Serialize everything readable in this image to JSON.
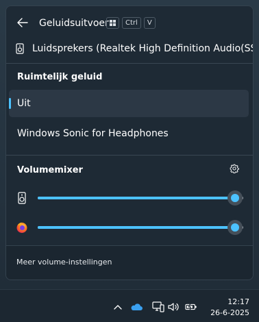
{
  "header": {
    "title": "Geluidsuitvoer",
    "shortcut_keys": [
      "Ctrl",
      "V"
    ]
  },
  "device": {
    "label": "Luidsprekers (Realtek High Definition Audio(SST))",
    "icon": "speaker-icon"
  },
  "spatial_sound": {
    "title": "Ruimtelijk geluid",
    "options": [
      {
        "label": "Uit",
        "selected": true
      },
      {
        "label": "Windows Sonic for Headphones",
        "selected": false
      }
    ]
  },
  "mixer": {
    "title": "Volumemixer",
    "settings_icon": "gear-icon",
    "rows": [
      {
        "app_icon": "speaker-icon",
        "volume_fraction": 0.96
      },
      {
        "app_icon": "firefox-icon",
        "volume_fraction": 0.96
      }
    ]
  },
  "footer": {
    "link": "Meer volume-instellingen"
  },
  "taskbar": {
    "time": "12:17",
    "date": "26-6-2025",
    "tray_icons": [
      "chevron-up-icon",
      "onedrive-icon",
      "network-icon",
      "volume-icon",
      "battery-icon"
    ]
  },
  "colors": {
    "accent": "#4cc2ff",
    "flyout_background": "#1e2a35",
    "selected_background": "#2c3845"
  }
}
